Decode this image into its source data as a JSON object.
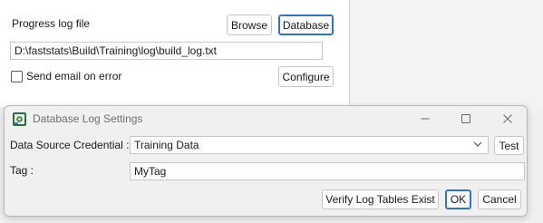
{
  "settings": {
    "progress_label": "Progress log file",
    "browse_label": "Browse",
    "database_label": "Database",
    "path_value": "D:\\faststats\\Build\\Training\\log\\build_log.txt",
    "email_label": "Send email on error",
    "configure_label": "Configure"
  },
  "dialog": {
    "title": "Database Log Settings",
    "credential_label": "Data Source Credential :",
    "credential_value": "Training Data",
    "test_label": "Test",
    "tag_label": "Tag :",
    "tag_value": "MyTag",
    "verify_label": "Verify Log Tables Exist",
    "ok_label": "OK",
    "cancel_label": "Cancel"
  },
  "colors": {
    "focus_border": "#2e74c9",
    "title_text": "#6f6f6f"
  }
}
